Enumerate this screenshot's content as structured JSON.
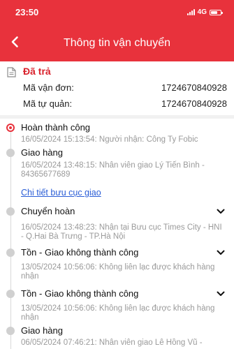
{
  "status_bar": {
    "time": "23:50",
    "network": "4G",
    "battery_level": 0.7
  },
  "header": {
    "title": "Thông tin vận chuyển",
    "back_icon": "chevron-left-icon",
    "background": "#e8323c"
  },
  "summary": {
    "status": "Đã trả",
    "status_color": "#d9232d",
    "fields": [
      {
        "label": "Mã vận đơn:",
        "value": "1724670840928"
      },
      {
        "label": "Mã tự quản:",
        "value": "1724670840928"
      }
    ]
  },
  "timeline": {
    "link_label": "Chi tiết bưu cục giao",
    "events": [
      {
        "title": "Hoàn thành công",
        "desc": "16/05/2024 15:13:54: Người nhận: Công Ty Fobic",
        "active": true,
        "expandable": false
      },
      {
        "title": "Giao hàng",
        "desc": "16/05/2024 13:48:15: Nhân viên giao Lý Tiến Bình - 84365677689",
        "active": false,
        "expandable": false
      },
      {
        "title": "Chuyển hoàn",
        "desc": "16/05/2024 13:48:23: Nhận tại Bưu cục Times City - HNI - Q.Hai Bà Trưng - TP.Hà Nội",
        "active": false,
        "expandable": true
      },
      {
        "title": "Tồn - Giao không thành công",
        "desc": "13/05/2024 10:56:06: Không liên lạc được khách hàng nhận",
        "active": false,
        "expandable": true
      },
      {
        "title": "Tồn - Giao không thành công",
        "desc": "13/05/2024 10:56:06: Không liên lạc được khách hàng nhận",
        "active": false,
        "expandable": true
      },
      {
        "title": "Giao hàng",
        "desc": "06/05/2024 07:46:21: Nhân viên giao Lê Hồng Vũ -",
        "active": false,
        "expandable": false
      }
    ]
  }
}
